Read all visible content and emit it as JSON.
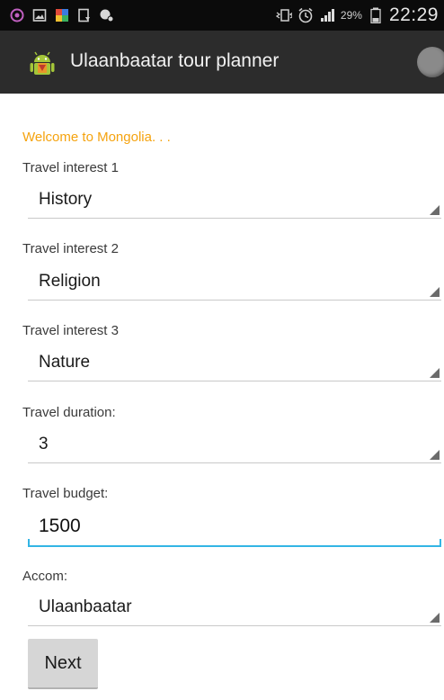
{
  "status_bar": {
    "battery_percent": "29%",
    "time": "22:29"
  },
  "action_bar": {
    "title": "Ulaanbaatar tour planner"
  },
  "form": {
    "welcome": "Welcome to Mongolia. . .",
    "interest1": {
      "label": "Travel interest 1",
      "value": "History"
    },
    "interest2": {
      "label": "Travel interest 2",
      "value": "Religion"
    },
    "interest3": {
      "label": "Travel interest 3",
      "value": "Nature"
    },
    "duration": {
      "label": "Travel duration:",
      "value": "3"
    },
    "budget": {
      "label": "Travel budget:",
      "value": "1500"
    },
    "accom": {
      "label": "Accom:",
      "value": "Ulaanbaatar"
    },
    "next_label": "Next"
  },
  "colors": {
    "welcome_text": "#f5a30f",
    "edit_underline": "#33b5e5",
    "action_bar_bg": "#2c2c2c"
  },
  "icons": [
    "notification-app-icon",
    "gallery-icon",
    "multicolor-app-icon",
    "download-icon",
    "sync-icon",
    "vibrate-icon",
    "alarm-icon",
    "signal-icon",
    "battery-icon",
    "android-app-icon"
  ]
}
